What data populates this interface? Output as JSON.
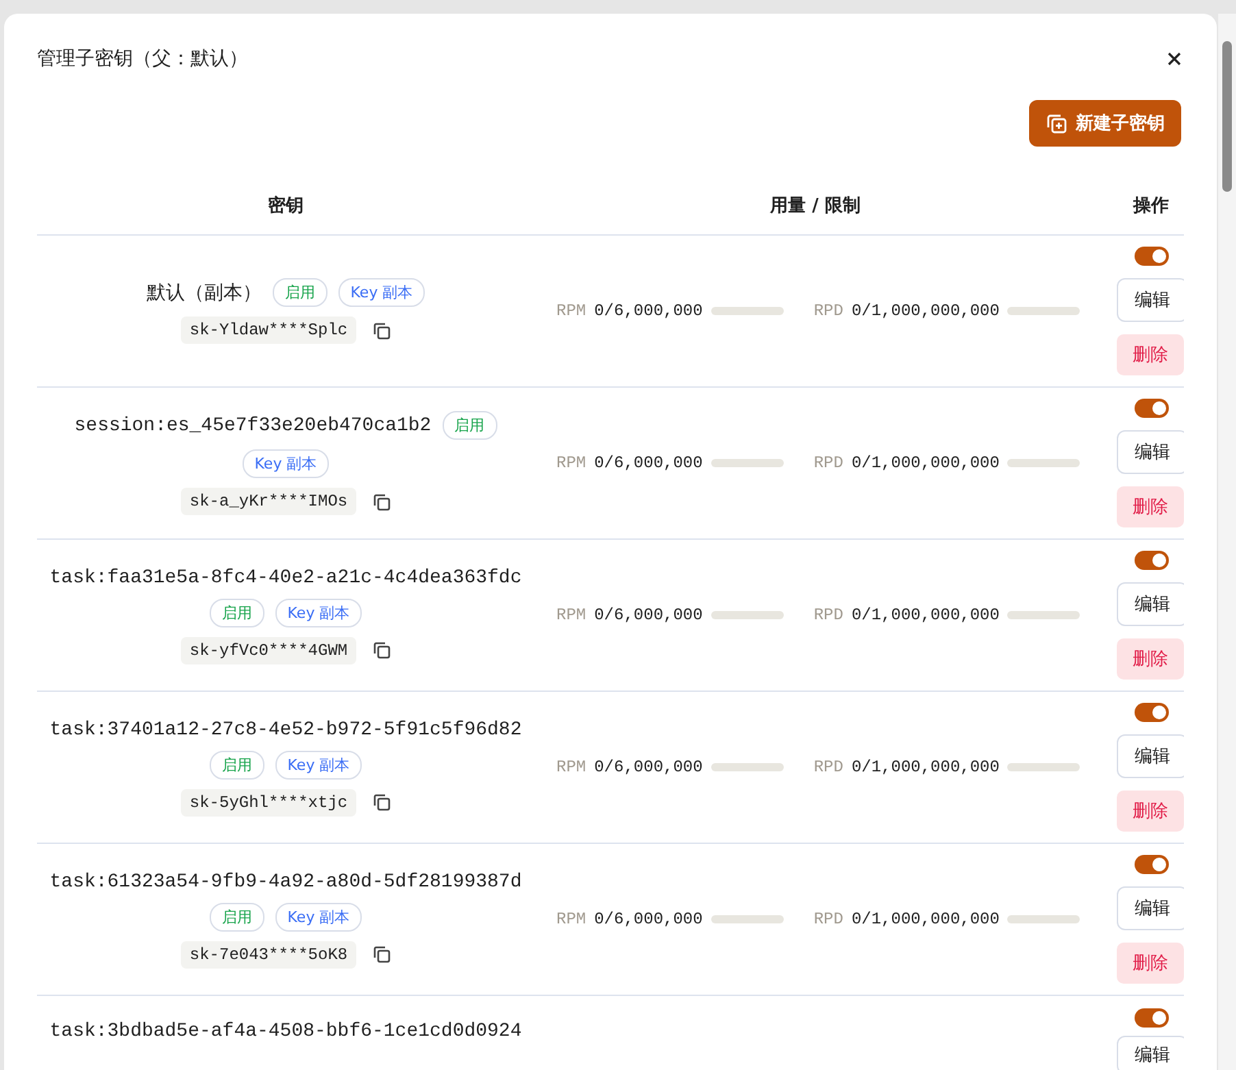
{
  "dialog": {
    "title": "管理子密钥（父：默认）",
    "create_button": "新建子密钥"
  },
  "table": {
    "columns": [
      "密钥",
      "用量 / 限制",
      "操作"
    ],
    "rows": [
      {
        "name": "默认（副本）",
        "badges": [
          {
            "kind": "status",
            "text": "启用"
          },
          {
            "kind": "copy",
            "text": "Key 副本"
          }
        ],
        "key_mask": "sk-Yldaw****Splc",
        "limits": [
          {
            "label": "RPM",
            "value": "0/6,000,000",
            "level": 0
          },
          {
            "label": "RPD",
            "value": "0/1,000,000,000",
            "level": 0
          }
        ],
        "enabled": true,
        "edit": "编辑",
        "delete": "删除"
      },
      {
        "name": "session:es_45e7f33e20eb470ca1b2",
        "badges": [
          {
            "kind": "status",
            "text": "启用"
          },
          {
            "kind": "copy",
            "text": "Key 副本"
          }
        ],
        "key_mask": "sk-a_yKr****IMOs",
        "limits": [
          {
            "label": "RPM",
            "value": "0/6,000,000",
            "level": 0
          },
          {
            "label": "RPD",
            "value": "0/1,000,000,000",
            "level": 0
          }
        ],
        "enabled": true,
        "edit": "编辑",
        "delete": "删除"
      },
      {
        "name": "task:faa31e5a-8fc4-40e2-a21c-4c4dea363fdc",
        "badges": [
          {
            "kind": "status",
            "text": "启用"
          },
          {
            "kind": "copy",
            "text": "Key 副本"
          }
        ],
        "key_mask": "sk-yfVc0****4GWM",
        "limits": [
          {
            "label": "RPM",
            "value": "0/6,000,000",
            "level": 0
          },
          {
            "label": "RPD",
            "value": "0/1,000,000,000",
            "level": 0
          }
        ],
        "enabled": true,
        "edit": "编辑",
        "delete": "删除"
      },
      {
        "name": "task:37401a12-27c8-4e52-b972-5f91c5f96d82",
        "badges": [
          {
            "kind": "status",
            "text": "启用"
          },
          {
            "kind": "copy",
            "text": "Key 副本"
          }
        ],
        "key_mask": "sk-5yGhl****xtjc",
        "limits": [
          {
            "label": "RPM",
            "value": "0/6,000,000",
            "level": 0
          },
          {
            "label": "RPD",
            "value": "0/1,000,000,000",
            "level": 0
          }
        ],
        "enabled": true,
        "edit": "编辑",
        "delete": "删除"
      },
      {
        "name": "task:61323a54-9fb9-4a92-a80d-5df28199387d",
        "badges": [
          {
            "kind": "status",
            "text": "启用"
          },
          {
            "kind": "copy",
            "text": "Key 副本"
          }
        ],
        "key_mask": "sk-7e043****5oK8",
        "limits": [
          {
            "label": "RPM",
            "value": "0/6,000,000",
            "level": 0
          },
          {
            "label": "RPD",
            "value": "0/1,000,000,000",
            "level": 0
          }
        ],
        "enabled": true,
        "edit": "编辑",
        "delete": "删除"
      },
      {
        "name": "task:3bdbad5e-af4a-4508-bbf6-1ce1cd0d0924",
        "enabled": true,
        "edit": "编辑"
      }
    ]
  }
}
